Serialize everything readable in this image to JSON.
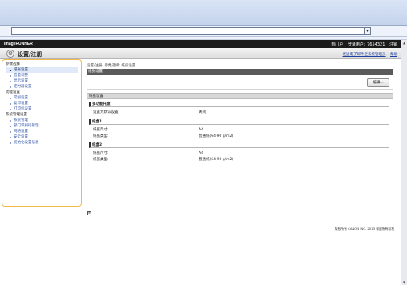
{
  "browser": {
    "address_dropdown_glyph": "▾",
    "scroll_up_glyph": "▲",
    "scroll_down_glyph": "▼"
  },
  "header": {
    "brand": "imageRUNNER",
    "portal_link": "到门户",
    "login_label": "登录用户:",
    "login_user": "7654321",
    "logout_link": "注销"
  },
  "title_bar": {
    "title": "设置/注册",
    "icon": "gear-icon",
    "links": [
      "发送电子邮件至系统管理员",
      "帮助"
    ]
  },
  "sidebar": {
    "groups": [
      {
        "label": "参数选择",
        "items": [
          {
            "label": "纸张设置",
            "active": true
          },
          {
            "label": "音量调整",
            "active": false
          },
          {
            "label": "显示设置",
            "active": false
          },
          {
            "label": "定时器设置",
            "active": false
          }
        ]
      },
      {
        "label": "功能设置",
        "items": [
          {
            "label": "常规设置",
            "active": false
          },
          {
            "label": "复印设置",
            "active": false
          },
          {
            "label": "打印机设置",
            "active": false
          }
        ]
      },
      {
        "label": "系统管理设置",
        "items": [
          {
            "label": "系统管理",
            "active": false
          },
          {
            "label": "部门识别码管理",
            "active": false
          },
          {
            "label": "网络设置",
            "active": false
          },
          {
            "label": "安全设置",
            "active": false
          },
          {
            "label": "初始化设置信息",
            "active": false
          }
        ]
      }
    ]
  },
  "main": {
    "breadcrumb": "设置/注册: 参数选择: 纸张设置",
    "section_title": "纸张设置",
    "edit_button": "编辑...",
    "subsection_title": "纸张设置",
    "multipurpose": {
      "heading": "多功能托盘",
      "rows": [
        {
          "key": "设置为默认设置:",
          "value": "关闭"
        }
      ]
    },
    "drawer1": {
      "heading": "纸盒1",
      "rows": [
        {
          "key": "纸张尺寸:",
          "value": "A4"
        },
        {
          "key": "纸张类型:",
          "value": "普通纸(64-90 g/m2)"
        }
      ]
    },
    "drawer2": {
      "heading": "纸盒2",
      "rows": [
        {
          "key": "纸张尺寸:",
          "value": "A4"
        },
        {
          "key": "纸张类型:",
          "value": "普通纸(64-90 g/m2)"
        }
      ]
    },
    "mini_icon_glyph": "≡",
    "copyright": "版权所有 CANON INC. 2013 保留所有权利"
  }
}
